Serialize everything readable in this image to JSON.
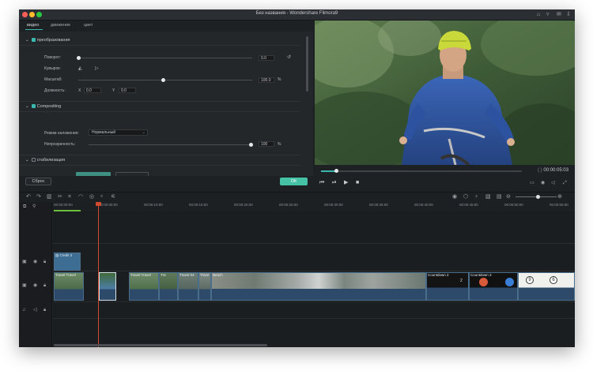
{
  "window": {
    "title": "Без названия - Wondershare Filmora9",
    "traffic_colors": [
      "#ff5f57",
      "#febc2e",
      "#28c840"
    ]
  },
  "tabs": [
    {
      "label": "видео",
      "active": true
    },
    {
      "label": "движение",
      "active": false
    },
    {
      "label": "цвет",
      "active": false
    }
  ],
  "transform": {
    "header": "преобразования",
    "rotation_label": "Поворот:",
    "rotation_value": "0.0",
    "flip_label": "Кувырок:",
    "scale_label": "Масштаб:",
    "scale_value": "100.0",
    "scale_unit": "%",
    "position_label": "Должность:",
    "x_label": "X",
    "x_value": "0.0",
    "y_label": "Y",
    "y_value": "0.0"
  },
  "compositing": {
    "header": "Compositing",
    "blend_label": "Режим наложения:",
    "blend_value": "Нормальный",
    "opacity_label": "Непрозрачность:",
    "opacity_value": "100",
    "opacity_unit": "%"
  },
  "stabilization": {
    "header": "стабилизация"
  },
  "buttons": {
    "reset": "Сброс",
    "ok": "ОК"
  },
  "preview": {
    "timecode": "00:00:05:03",
    "scrub_progress": 0.08
  },
  "ruler": {
    "ticks": [
      "00:00:00:00",
      "00:00:05:00",
      "00:00:10:00",
      "00:00:15:00",
      "00:00:20:00",
      "00:00:25:00",
      "00:00:30:00",
      "00:00:35:00",
      "00:00:40:00",
      "00:00:45:00",
      "00:00:50:00",
      "00:00:55:00"
    ]
  },
  "clips": {
    "title_clip": "Credit 2",
    "c1": "Travel Travel",
    "c2": "Travel Travel",
    "c3": "Tra",
    "c4": "Travel 04",
    "c5": "Trave",
    "c6": "Beach",
    "c7": "Countdown 2",
    "c8": "Countdown 3",
    "cd_nums": [
      "2",
      "9",
      "6"
    ]
  },
  "icons": {
    "toolbar": [
      "undo-icon",
      "redo-icon",
      "delete-icon",
      "cut-icon",
      "crop-icon",
      "speed-icon",
      "color-icon",
      "audio-icon",
      "split-icon"
    ]
  }
}
